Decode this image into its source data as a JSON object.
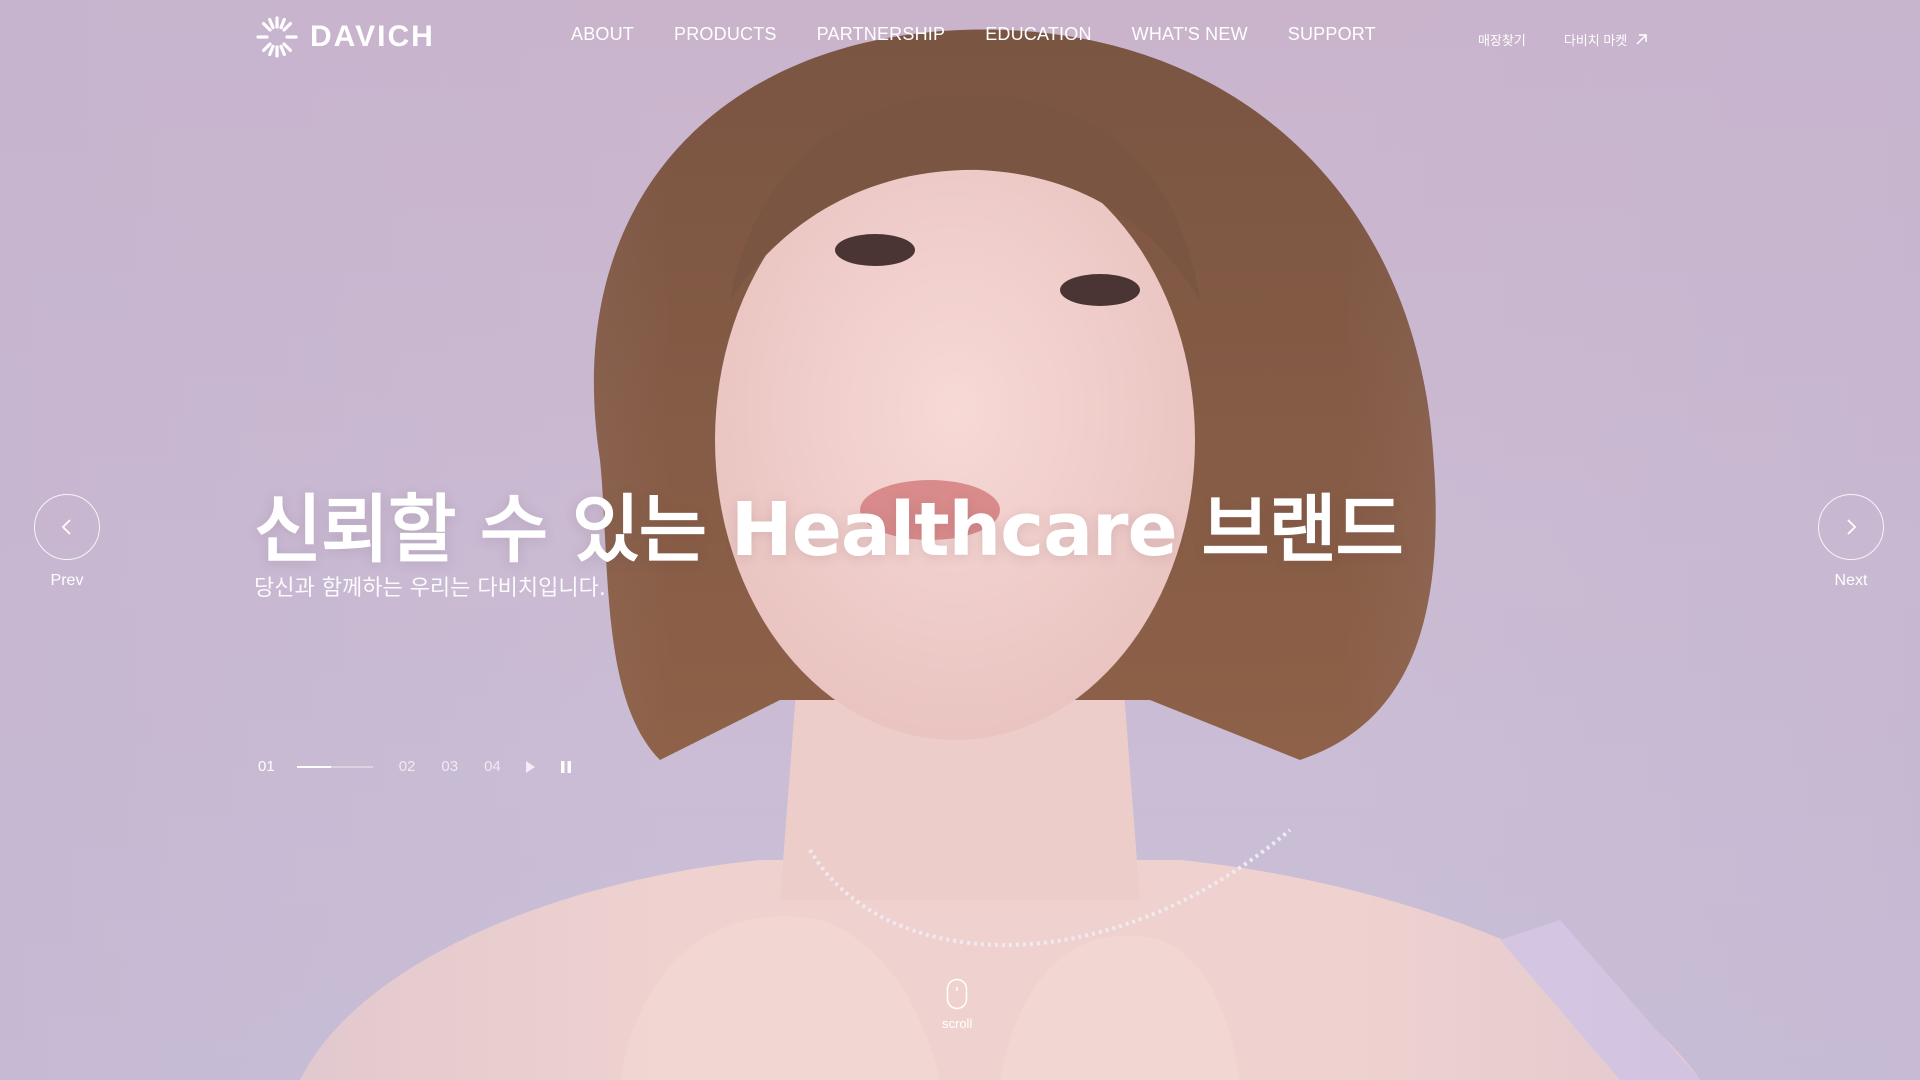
{
  "brand": {
    "name": "DAVICH",
    "logo_icon": "sunburst-logo-icon"
  },
  "nav": {
    "items": [
      {
        "label": "ABOUT"
      },
      {
        "label": "PRODUCTS"
      },
      {
        "label": "PARTNERSHIP"
      },
      {
        "label": "EDUCATION"
      },
      {
        "label": "WHAT'S NEW"
      },
      {
        "label": "SUPPORT"
      }
    ],
    "util": [
      {
        "label": "매장찾기"
      },
      {
        "label": "다비치 마켓",
        "icon": "external-arrow-icon"
      }
    ]
  },
  "hero": {
    "headline": "신뢰할 수 있는 Healthcare 브랜드",
    "subline": "당신과 함께하는 우리는 다비치입니다.",
    "prev_label": "Prev",
    "next_label": "Next",
    "slides": [
      "01",
      "02",
      "03",
      "04"
    ],
    "active_slide": "01",
    "progress": 0.45,
    "scroll_label": "scroll"
  },
  "colors": {
    "background": "#c9b4cc",
    "text": "#ffffff"
  }
}
